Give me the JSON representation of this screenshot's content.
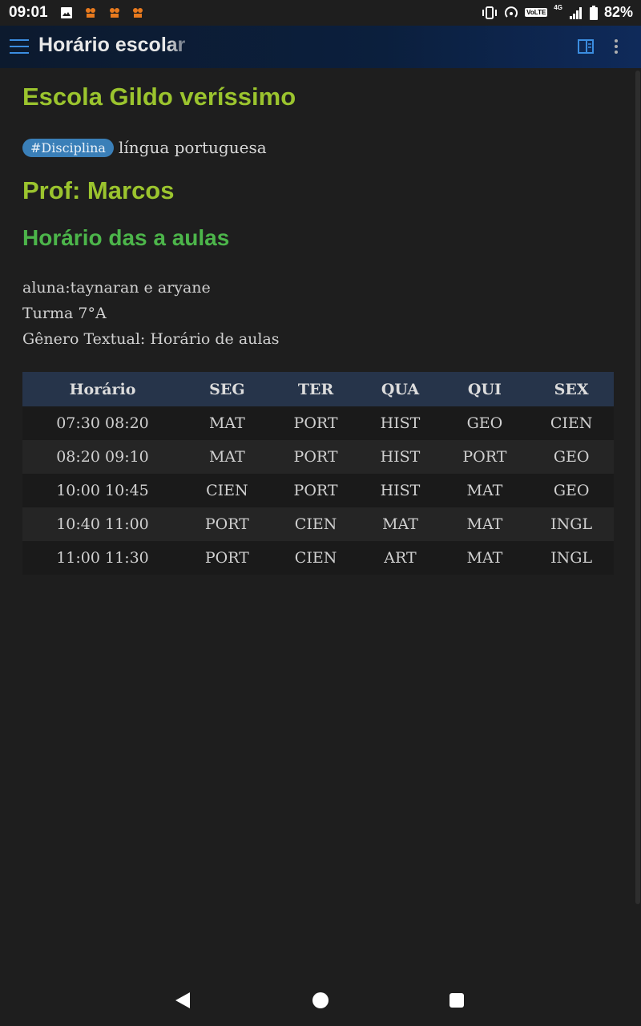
{
  "status_bar": {
    "time": "09:01",
    "network_label": "VoLTE",
    "network_type": "4G",
    "battery": "82%",
    "icons": [
      "image-icon",
      "app-notification-icon",
      "app-notification-icon",
      "app-notification-icon",
      "vibrate-icon",
      "hotspot-icon",
      "signal-icon",
      "battery-icon"
    ]
  },
  "app_bar": {
    "title": "Horário escolar",
    "accent_color": "#3b8de0"
  },
  "note": {
    "school_heading": "Escola Gildo veríssimo",
    "tag": "#Disciplina",
    "subject": "língua portuguesa",
    "professor_heading": "Prof: Marcos",
    "schedule_heading": "Horário das a aulas",
    "info_lines": [
      "aluna:taynaran e aryane",
      "Turma 7°A",
      "Gênero Textual: Horário de aulas"
    ],
    "colors": {
      "heading_primary": "#9bc42e",
      "heading_secondary": "#4cb54a",
      "tag_background": "#3a7fb8",
      "table_header_background": "#26344a"
    }
  },
  "table": {
    "headers": [
      "Horário",
      "SEG",
      "TER",
      "QUA",
      "QUI",
      "SEX"
    ],
    "rows": [
      [
        "07:30 08:20",
        "MAT",
        "PORT",
        "HIST",
        "GEO",
        "CIEN"
      ],
      [
        "08:20 09:10",
        "MAT",
        "PORT",
        "HIST",
        "PORT",
        "GEO"
      ],
      [
        "10:00 10:45",
        "CIEN",
        "PORT",
        "HIST",
        "MAT",
        "GEO"
      ],
      [
        "10:40 11:00",
        "PORT",
        "CIEN",
        "MAT",
        "MAT",
        "INGL"
      ],
      [
        "11:00 11:30",
        "PORT",
        "CIEN",
        "ART",
        "MAT",
        "INGL"
      ]
    ]
  }
}
